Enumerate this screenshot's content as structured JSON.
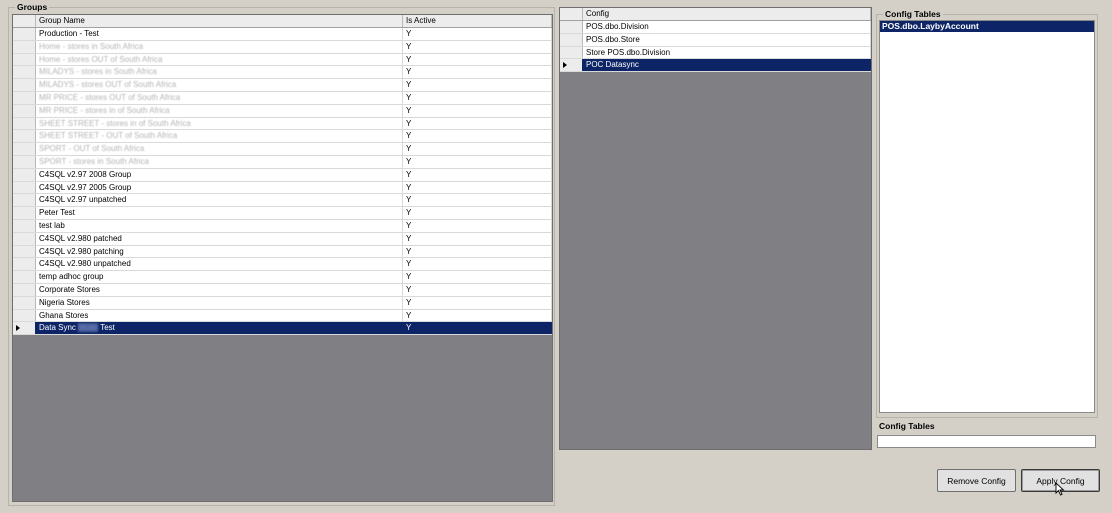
{
  "groups": {
    "title": "Groups",
    "columns": [
      "Group Name",
      "Is Active"
    ],
    "rows": [
      {
        "name": "Production - Test",
        "active": "Y",
        "blurred": false,
        "selected": false
      },
      {
        "name": "Home - stores in South Africa",
        "active": "Y",
        "blurred": true,
        "selected": false
      },
      {
        "name": "Home - stores OUT of South Africa",
        "active": "Y",
        "blurred": true,
        "selected": false
      },
      {
        "name": "MILADYS - stores in South Africa",
        "active": "Y",
        "blurred": true,
        "selected": false
      },
      {
        "name": "MILADYS - stores OUT of South Africa",
        "active": "Y",
        "blurred": true,
        "selected": false
      },
      {
        "name": "MR PRICE - stores OUT of South Africa",
        "active": "Y",
        "blurred": true,
        "selected": false
      },
      {
        "name": "MR PRICE - stores in of South Africa",
        "active": "Y",
        "blurred": true,
        "selected": false
      },
      {
        "name": "SHEET STREET - stores in of South Africa",
        "active": "Y",
        "blurred": true,
        "selected": false
      },
      {
        "name": "SHEET STREET - OUT of South Africa",
        "active": "Y",
        "blurred": true,
        "selected": false
      },
      {
        "name": "SPORT - OUT of South Africa",
        "active": "Y",
        "blurred": true,
        "selected": false
      },
      {
        "name": "SPORT - stores in South Africa",
        "active": "Y",
        "blurred": true,
        "selected": false
      },
      {
        "name": "C4SQL v2.97 2008 Group",
        "active": "Y",
        "blurred": false,
        "selected": false
      },
      {
        "name": "C4SQL v2.97 2005 Group",
        "active": "Y",
        "blurred": false,
        "selected": false
      },
      {
        "name": "C4SQL v2.97 unpatched",
        "active": "Y",
        "blurred": false,
        "selected": false
      },
      {
        "name": "Peter Test",
        "active": "Y",
        "blurred": false,
        "selected": false
      },
      {
        "name": "test lab",
        "active": "Y",
        "blurred": false,
        "selected": false
      },
      {
        "name": "C4SQL v2.980 patched",
        "active": "Y",
        "blurred": false,
        "selected": false
      },
      {
        "name": "C4SQL v2.980 patching",
        "active": "Y",
        "blurred": false,
        "selected": false
      },
      {
        "name": "C4SQL v2.980 unpatched",
        "active": "Y",
        "blurred": false,
        "selected": false
      },
      {
        "name": "temp adhoc group",
        "active": "Y",
        "blurred": false,
        "selected": false
      },
      {
        "name": "Corporate Stores",
        "active": "Y",
        "blurred": false,
        "selected": false
      },
      {
        "name": "Nigeria Stores",
        "active": "Y",
        "blurred": false,
        "selected": false
      },
      {
        "name": "Ghana Stores",
        "active": "Y",
        "blurred": false,
        "selected": false
      },
      {
        "name_parts": [
          "Data Sync ",
          "Mralo",
          " Test"
        ],
        "active": "Y",
        "blurred": false,
        "selected": true
      }
    ]
  },
  "config": {
    "column": "Config",
    "rows": [
      {
        "name": "POS.dbo.Division",
        "selected": false
      },
      {
        "name": "POS.dbo.Store",
        "selected": false
      },
      {
        "name": "Store POS.dbo.Division",
        "selected": false
      },
      {
        "name": "POC Datasync",
        "selected": true
      }
    ]
  },
  "config_tables": {
    "title": "Config Tables",
    "items": [
      {
        "name": "POS.dbo.LaybyAccount",
        "selected": true
      }
    ],
    "input_label": "Config Tables",
    "input_value": ""
  },
  "buttons": {
    "remove_config": "Remove Config",
    "apply_config": "Apply Config"
  },
  "colors": {
    "selection": "#0d2566",
    "window_bg": "#d4d0c8",
    "grid_bg": "#808084"
  }
}
